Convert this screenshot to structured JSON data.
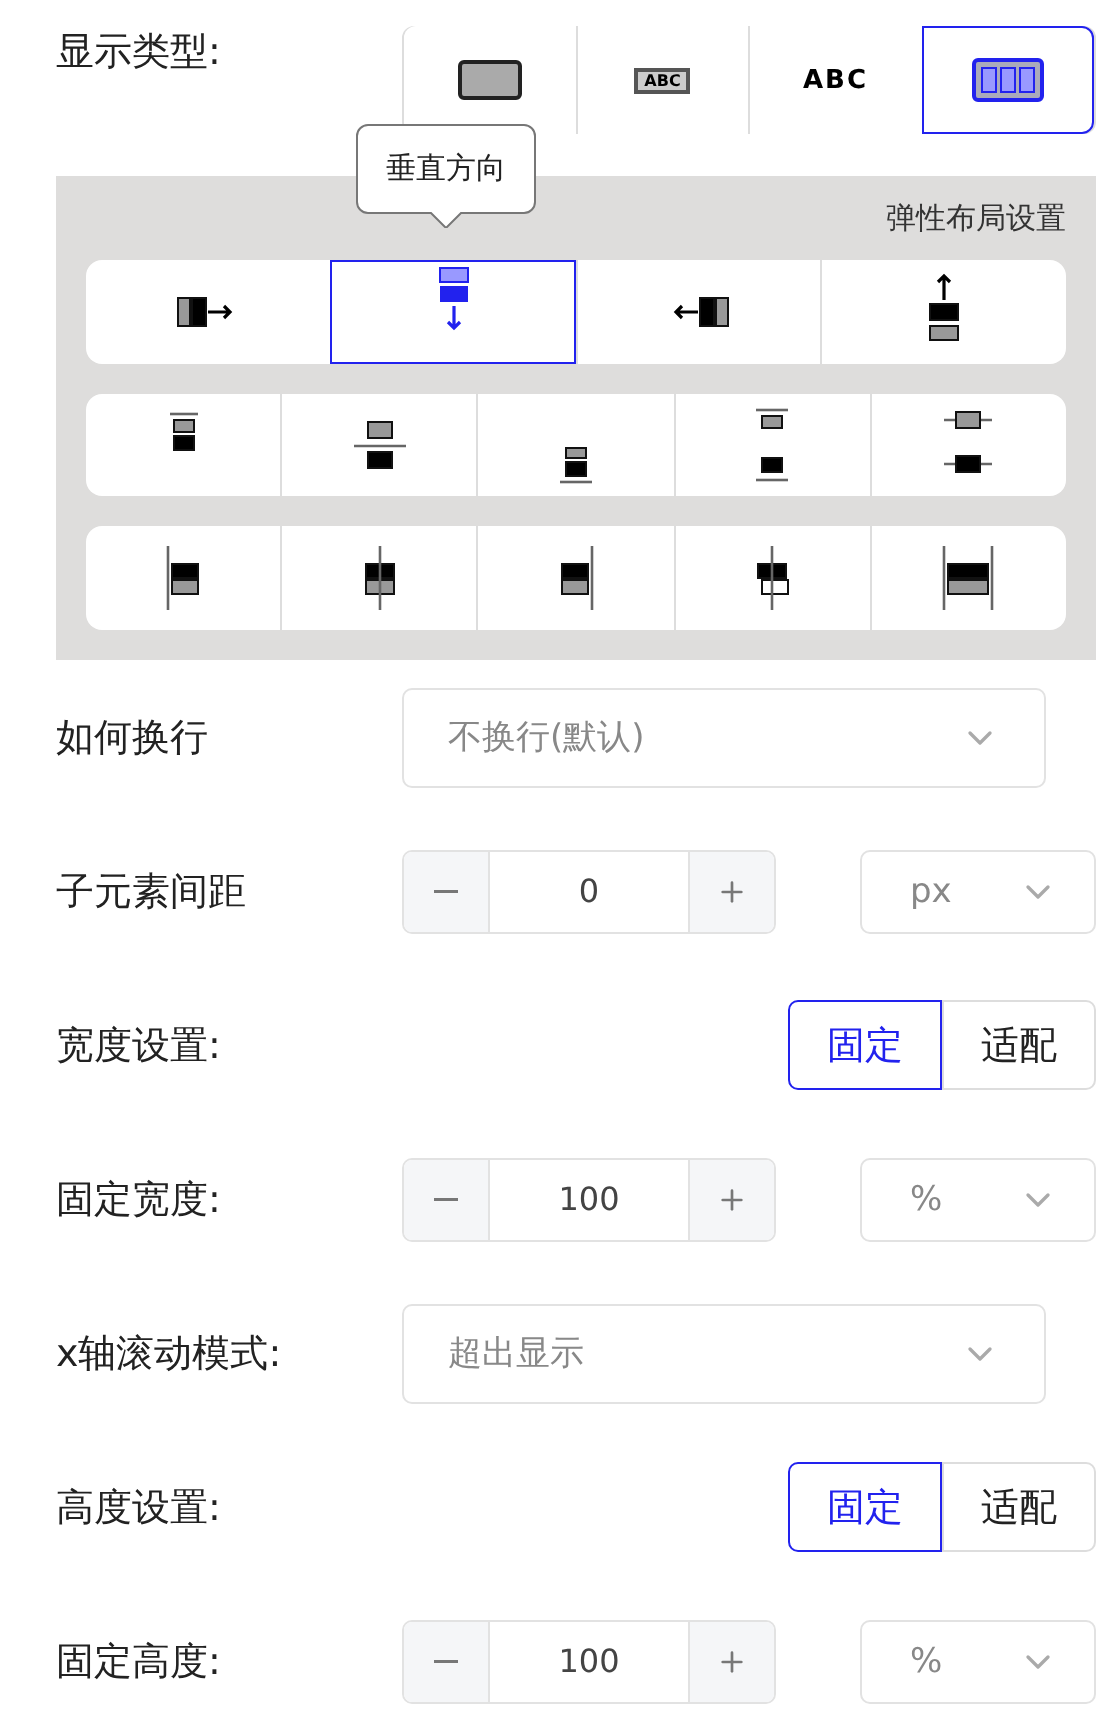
{
  "display_type": {
    "label": "显示类型:",
    "options": [
      {
        "kind": "block",
        "selected": false
      },
      {
        "kind": "inline-block",
        "text": "ABC",
        "selected": false
      },
      {
        "kind": "inline",
        "text": "ABC",
        "selected": false
      },
      {
        "kind": "flex",
        "selected": true
      }
    ]
  },
  "flex_panel": {
    "title": "弹性布局设置",
    "tooltip": "垂直方向",
    "direction": [
      {
        "kind": "row",
        "selected": false
      },
      {
        "kind": "column",
        "selected": true
      },
      {
        "kind": "row-reverse",
        "selected": false
      },
      {
        "kind": "column-reverse",
        "selected": false
      }
    ],
    "justify": [
      {
        "kind": "start"
      },
      {
        "kind": "center"
      },
      {
        "kind": "end"
      },
      {
        "kind": "space-between"
      },
      {
        "kind": "space-around"
      }
    ],
    "align": [
      {
        "kind": "start"
      },
      {
        "kind": "center"
      },
      {
        "kind": "end"
      },
      {
        "kind": "baseline"
      },
      {
        "kind": "stretch"
      }
    ]
  },
  "fields": [
    {
      "kind": "select",
      "label": "如何换行",
      "value": "不换行(默认)"
    },
    {
      "kind": "stepper",
      "label": "子元素间距",
      "value": "0",
      "unit": "px"
    },
    {
      "kind": "toggle",
      "label": "宽度设置:",
      "options": [
        {
          "label": "固定",
          "selected": true
        },
        {
          "label": "适配",
          "selected": false
        }
      ]
    },
    {
      "kind": "stepper",
      "label": "固定宽度:",
      "value": "100",
      "unit": "%"
    },
    {
      "kind": "select",
      "label": "x轴滚动模式:",
      "value": "超出显示"
    },
    {
      "kind": "toggle",
      "label": "高度设置:",
      "options": [
        {
          "label": "固定",
          "selected": true
        },
        {
          "label": "适配",
          "selected": false
        }
      ]
    },
    {
      "kind": "stepper",
      "label": "固定高度:",
      "value": "100",
      "unit": "%"
    }
  ]
}
